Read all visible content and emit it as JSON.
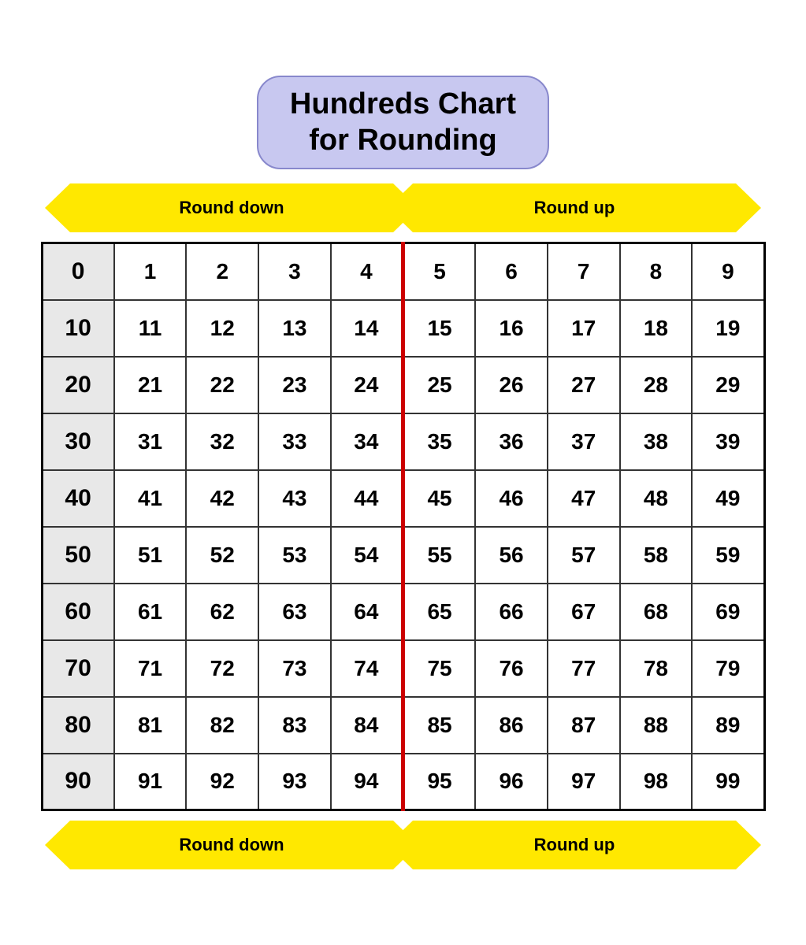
{
  "title": {
    "line1": "Hundreds Chart",
    "line2": "for Rounding"
  },
  "arrows": {
    "round_down": "Round down",
    "round_up": "Round up"
  },
  "table": {
    "rows": [
      {
        "tens": "0",
        "cells": [
          "1",
          "2",
          "3",
          "4",
          "5",
          "6",
          "7",
          "8",
          "9"
        ]
      },
      {
        "tens": "10",
        "cells": [
          "11",
          "12",
          "13",
          "14",
          "15",
          "16",
          "17",
          "18",
          "19"
        ]
      },
      {
        "tens": "20",
        "cells": [
          "21",
          "22",
          "23",
          "24",
          "25",
          "26",
          "27",
          "28",
          "29"
        ]
      },
      {
        "tens": "30",
        "cells": [
          "31",
          "32",
          "33",
          "34",
          "35",
          "36",
          "37",
          "38",
          "39"
        ]
      },
      {
        "tens": "40",
        "cells": [
          "41",
          "42",
          "43",
          "44",
          "45",
          "46",
          "47",
          "48",
          "49"
        ]
      },
      {
        "tens": "50",
        "cells": [
          "51",
          "52",
          "53",
          "54",
          "55",
          "56",
          "57",
          "58",
          "59"
        ]
      },
      {
        "tens": "60",
        "cells": [
          "61",
          "62",
          "63",
          "64",
          "65",
          "66",
          "67",
          "68",
          "69"
        ]
      },
      {
        "tens": "70",
        "cells": [
          "71",
          "72",
          "73",
          "74",
          "75",
          "76",
          "77",
          "78",
          "79"
        ]
      },
      {
        "tens": "80",
        "cells": [
          "81",
          "82",
          "83",
          "84",
          "85",
          "86",
          "87",
          "88",
          "89"
        ]
      },
      {
        "tens": "90",
        "cells": [
          "91",
          "92",
          "93",
          "94",
          "95",
          "96",
          "97",
          "98",
          "99"
        ]
      }
    ]
  }
}
